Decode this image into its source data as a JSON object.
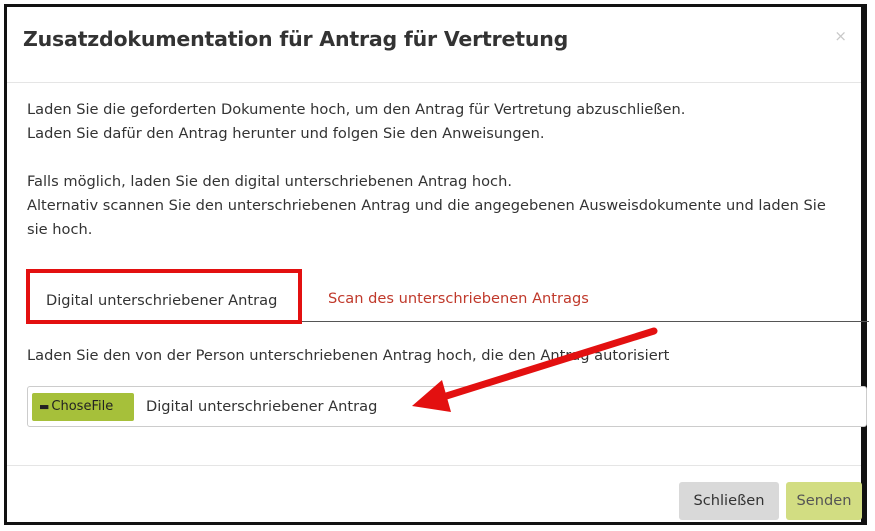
{
  "dialog": {
    "title": "Zusatzdokumentation für Antrag für Vertretung",
    "close_symbol": "×",
    "intro_line1": "Laden Sie die geforderten Dokumente hoch, um den Antrag für Vertretung abzuschließen.",
    "intro_line2": "Laden Sie dafür den Antrag herunter und folgen Sie den Anweisungen.",
    "info_line1": "Falls möglich, laden Sie den digital unterschriebenen Antrag hoch.",
    "info_line2": "Alternativ scannen Sie den unterschriebenen Antrag und die angegebenen Ausweisdokumente und laden Sie sie hoch."
  },
  "tabs": [
    {
      "label": "Digital unterschriebener Antrag",
      "active": true
    },
    {
      "label": "Scan des unterschriebenen Antrags",
      "active": false
    }
  ],
  "upload": {
    "instruction": "Laden Sie den von der Person unterschriebenen Antrag hoch, die den Antrag autorisiert",
    "button_label": "ChoseFile",
    "button_icon": "folder-icon",
    "file_label": "Digital unterschriebener Antrag"
  },
  "footer": {
    "close_label": "Schließen",
    "send_label": "Senden"
  },
  "colors": {
    "annotation_red": "#e31010",
    "choose_button": "#a6c03a",
    "send_button": "#d2dd82",
    "inactive_tab_text": "#c0392b"
  }
}
